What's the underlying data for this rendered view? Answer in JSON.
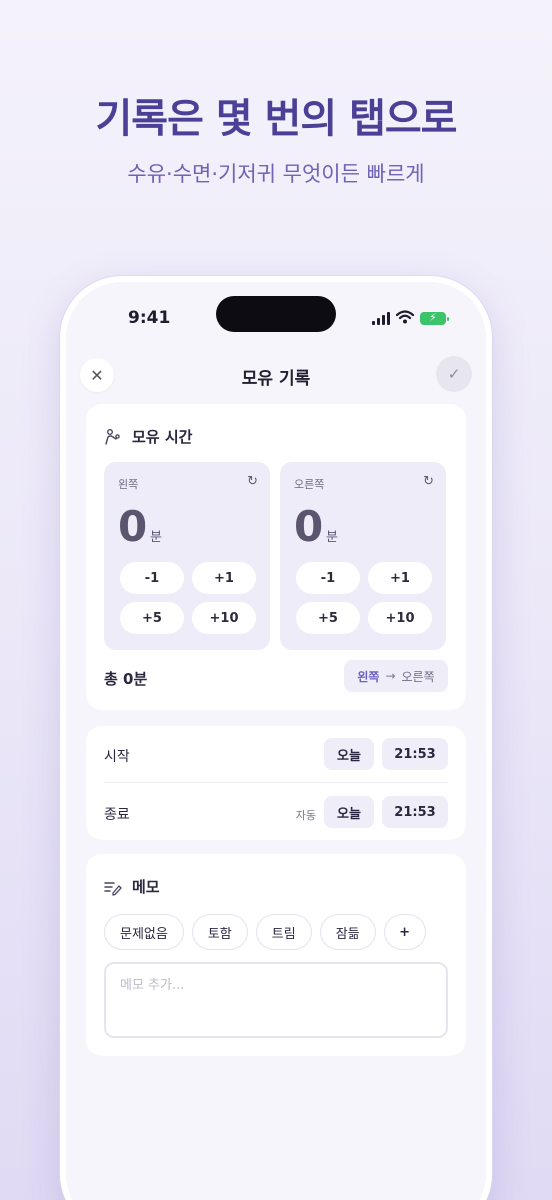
{
  "hero": {
    "title": "기록은 몇 번의 탭으로",
    "subtitle": "수유·수면·기저귀 무엇이든 빠르게"
  },
  "status_bar": {
    "time": "9:41",
    "icons": [
      "signal-icon",
      "wifi-icon",
      "battery-charging-icon"
    ]
  },
  "nav": {
    "title": "모유 기록",
    "close_icon": "close-icon",
    "confirm_icon": "check-icon"
  },
  "nursing": {
    "title": "모유 시간",
    "left": {
      "label": "왼쪽",
      "value": "0",
      "unit": "분"
    },
    "right": {
      "label": "오른쪽",
      "value": "0",
      "unit": "분"
    },
    "steps": [
      "-1",
      "+1",
      "+5",
      "+10"
    ],
    "total": "총 0분",
    "order": {
      "from": "왼쪽",
      "to": "오른쪽"
    }
  },
  "times": {
    "start": {
      "label": "시작",
      "day": "오늘",
      "time": "21:53"
    },
    "end": {
      "label": "종료",
      "auto": "자동",
      "day": "오늘",
      "time": "21:53"
    }
  },
  "memo": {
    "title": "메모",
    "tags": [
      "문제없음",
      "토함",
      "트림",
      "잠듦"
    ],
    "add_label": "+",
    "placeholder": "메모 추가..."
  },
  "colors": {
    "accent": "#6a5fc2",
    "hero_title": "#4b3f96",
    "chip_bg": "#efedf8"
  }
}
